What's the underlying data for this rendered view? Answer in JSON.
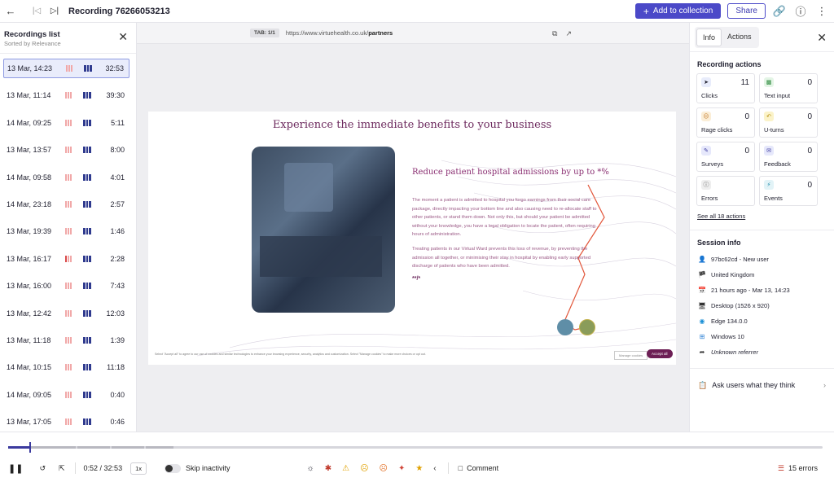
{
  "header": {
    "title": "Recording 76266053213",
    "add_label": "Add to collection",
    "share_label": "Share"
  },
  "recordings": {
    "title": "Recordings list",
    "subtitle": "Sorted by Relevance",
    "items": [
      {
        "date": "13 Mar, 14:23",
        "duration": "32:53"
      },
      {
        "date": "13 Mar, 11:14",
        "duration": "39:30"
      },
      {
        "date": "14 Mar, 09:25",
        "duration": "5:11"
      },
      {
        "date": "13 Mar, 13:57",
        "duration": "8:00"
      },
      {
        "date": "14 Mar, 09:58",
        "duration": "4:01"
      },
      {
        "date": "14 Mar, 23:18",
        "duration": "2:57"
      },
      {
        "date": "13 Mar, 19:39",
        "duration": "1:46"
      },
      {
        "date": "13 Mar, 16:17",
        "duration": "2:28"
      },
      {
        "date": "13 Mar, 16:00",
        "duration": "7:43"
      },
      {
        "date": "13 Mar, 12:42",
        "duration": "12:03"
      },
      {
        "date": "13 Mar, 11:18",
        "duration": "1:39"
      },
      {
        "date": "14 Mar, 10:15",
        "duration": "11:18"
      },
      {
        "date": "14 Mar, 09:05",
        "duration": "0:40"
      },
      {
        "date": "13 Mar, 17:05",
        "duration": "0:46"
      }
    ]
  },
  "player": {
    "tab_label": "TAB: 1/1",
    "url_prefix": "https://www.virtuehealth.co.uk/",
    "url_path": "partners",
    "page": {
      "title": "Experience the immediate benefits to your business",
      "subheading": "Reduce patient hospital admissions by up to *%",
      "para1": "The moment a patient is admitted to hospital you forgo earnings from their social care package, directly impacting your bottom line and also causing need to re-allocate staff to other patients, or stand them down. Not only this, but should your patient be admitted without your knowledge, you have a legal obligation to locate the patient, often requiring hours of administration.",
      "para2": "Treating patients in our Virtual Ward prevents this loss of revenue, by preventing the admission all together, or minimising their stay in hospital by enabling early supported discharge of patients who have been admitted.",
      "stars": "**/*",
      "cookie_text": "Select \"Accept all\" to agree to our use of cookies and similar technologies to enhance your browsing experience, security, analytics and customization. Select \"Manage cookies\" to make more choices or opt out.",
      "manage_label": "Manage cookies",
      "accept_label": "Accept all"
    }
  },
  "side": {
    "tab_info": "Info",
    "tab_actions": "Actions",
    "actions_title": "Recording actions",
    "actions": [
      {
        "label": "Clicks",
        "count": "11",
        "icon": "cursor-click-icon",
        "color": "#e8ecfb"
      },
      {
        "label": "Text input",
        "count": "0",
        "icon": "text-input-icon",
        "color": "#e4f5e6"
      },
      {
        "label": "Rage clicks",
        "count": "0",
        "icon": "rage-icon",
        "color": "#fbeed7"
      },
      {
        "label": "U-turns",
        "count": "0",
        "icon": "u-turn-icon",
        "color": "#fbf3c9"
      },
      {
        "label": "Surveys",
        "count": "0",
        "icon": "survey-icon",
        "color": "#e6e8fb"
      },
      {
        "label": "Feedback",
        "count": "0",
        "icon": "feedback-icon",
        "color": "#e6e8fb"
      },
      {
        "label": "Errors",
        "count": "",
        "icon": "error-icon",
        "color": "#eeeeee"
      },
      {
        "label": "Events",
        "count": "0",
        "icon": "events-icon",
        "color": "#e2f3f7"
      }
    ],
    "see_all": "See all 18 actions",
    "session_title": "Session info",
    "session": [
      {
        "icon": "user-icon",
        "text": "97bc62cd - New user"
      },
      {
        "icon": "flag-icon",
        "text": "United Kingdom"
      },
      {
        "icon": "calendar-icon",
        "text": "21 hours ago - Mar 13, 14:23"
      },
      {
        "icon": "desktop-icon",
        "text": "Desktop (1526 x 920)"
      },
      {
        "icon": "browser-icon",
        "text": "Edge 134.0.0"
      },
      {
        "icon": "windows-icon",
        "text": "Windows 10"
      },
      {
        "icon": "referrer-icon",
        "text": "Unknown referrer"
      }
    ],
    "ask_label": "Ask users what they think"
  },
  "bottom": {
    "time": "0:52 / 32:53",
    "speed": "1x",
    "skip_label": "Skip inactivity",
    "comment_label": "Comment",
    "errors_label": "15 errors",
    "progress_fraction": 0.027
  }
}
